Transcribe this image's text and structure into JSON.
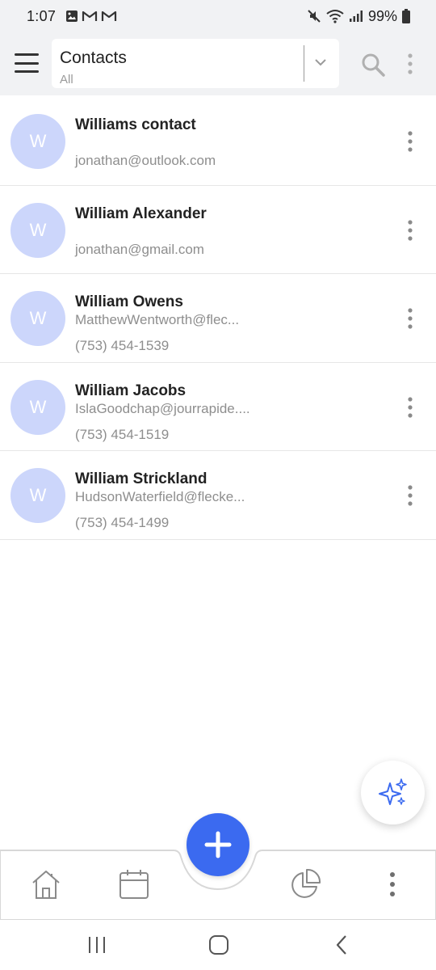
{
  "status_bar": {
    "time": "1:07",
    "battery": "99%",
    "left_icons": [
      "gallery-icon",
      "gmail-icon",
      "gmail-icon"
    ],
    "right_icons": [
      "mute-icon",
      "wifi-icon",
      "signal-icon",
      "battery-icon"
    ]
  },
  "header": {
    "view_title": "Contacts",
    "view_filter": "All"
  },
  "contacts": [
    {
      "initial": "W",
      "name": "Williams contact",
      "line1": "jonathan@outlook.com",
      "line2": ""
    },
    {
      "initial": "W",
      "name": "William Alexander",
      "line1": "jonathan@gmail.com",
      "line2": ""
    },
    {
      "initial": "W",
      "name": "William Owens",
      "line1": "MatthewWentworth@flec...",
      "line2": "(753) 454-1539"
    },
    {
      "initial": "W",
      "name": "William Jacobs",
      "line1": "IslaGoodchap@jourrapide....",
      "line2": "(753) 454-1519"
    },
    {
      "initial": "W",
      "name": "William Strickland",
      "line1": "HudsonWaterfield@flecke...",
      "line2": "(753) 454-1499"
    }
  ],
  "colors": {
    "accent": "#3b6af0",
    "avatar_bg": "#ccd6fb",
    "header_bg": "#f1f2f4"
  },
  "bottom_nav": [
    "home-icon",
    "calendar-icon",
    "add-icon",
    "pie-chart-icon",
    "more-icon"
  ]
}
